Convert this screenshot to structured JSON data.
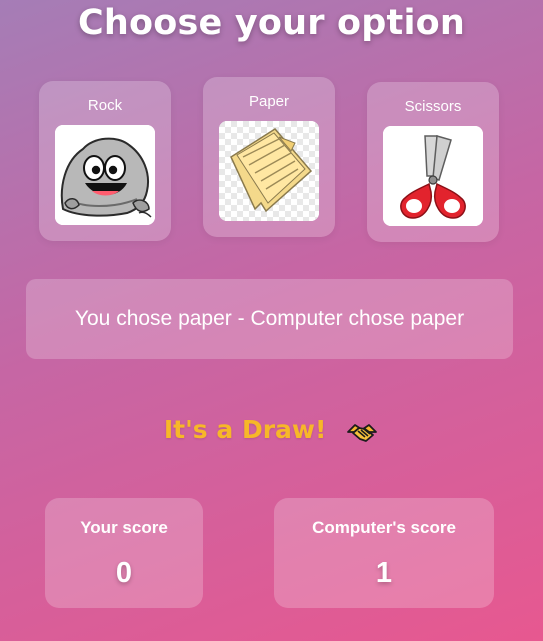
{
  "header": {
    "title": "Choose your option"
  },
  "options": [
    {
      "label": "Rock",
      "icon": "rock-icon"
    },
    {
      "label": "Paper",
      "icon": "paper-icon"
    },
    {
      "label": "Scissors",
      "icon": "scissors-icon"
    }
  ],
  "result": {
    "text": "You chose paper - Computer chose paper"
  },
  "outcome": {
    "text": "It's a Draw!",
    "icon": "handshake-icon",
    "color": "#f7b728"
  },
  "scores": {
    "you": {
      "label": "Your score",
      "value": "0"
    },
    "computer": {
      "label": "Computer's score",
      "value": "1"
    }
  },
  "colors": {
    "background_start": "#a57db6",
    "background_end": "#e75890",
    "card_fill": "rgba(255,255,255,0.22)"
  }
}
